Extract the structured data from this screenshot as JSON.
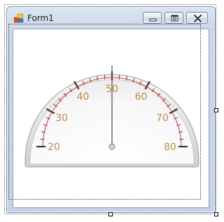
{
  "window": {
    "title": "Form1",
    "controls": {
      "minimize": "minimize-icon",
      "maximize": "maximize-icon",
      "close": "close-icon"
    }
  },
  "gauge": {
    "scale_labels": [
      "20",
      "30",
      "40",
      "50",
      "60",
      "70",
      "80"
    ],
    "min": 20,
    "max": 80,
    "value": 50,
    "colors": {
      "label": "#c08a4a",
      "range_arc": "#d03a3a",
      "needle": "#555555",
      "ticks": "#333333"
    }
  }
}
